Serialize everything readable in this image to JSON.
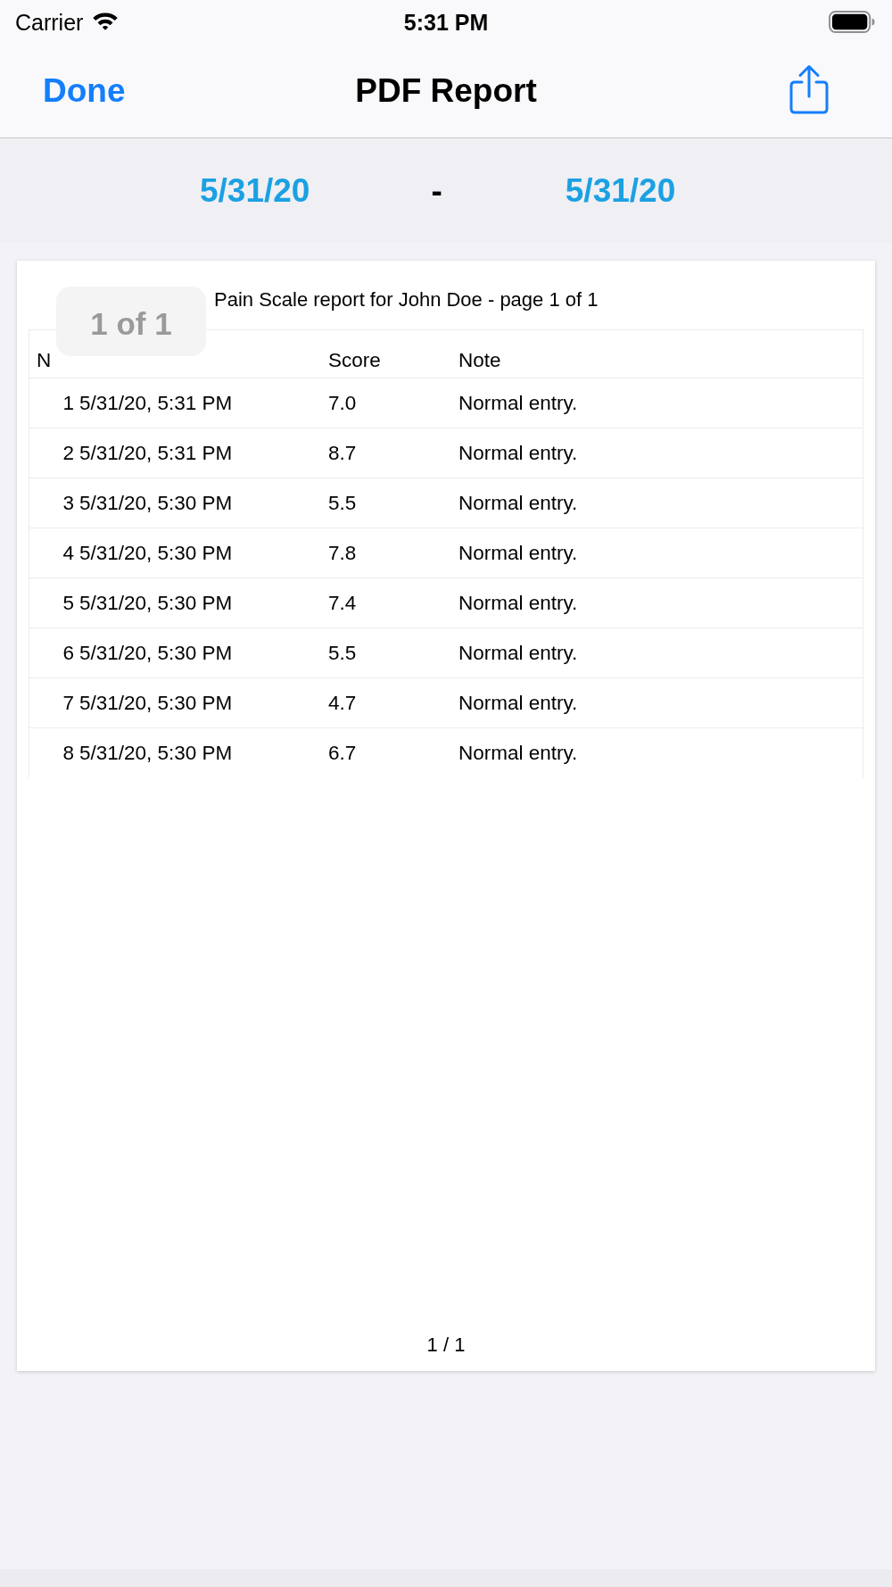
{
  "status_bar": {
    "carrier": "Carrier",
    "time": "5:31 PM"
  },
  "nav_bar": {
    "done_button": "Done",
    "title": "PDF Report"
  },
  "date_range": {
    "start": "5/31/20",
    "separator": "-",
    "end": "5/31/20"
  },
  "pdf_page": {
    "page_indicator": "1 of 1",
    "title": "Pain Scale report for John Doe - page 1 of 1",
    "table": {
      "header": {
        "column_1": "N",
        "column_3": "Score",
        "column_4": "Note"
      },
      "rows": [
        [
          "1",
          "5/31/20, 5:31 PM",
          "7.0",
          "Normal entry."
        ],
        [
          "2",
          "5/31/20, 5:31 PM",
          "8.7",
          "Normal entry."
        ],
        [
          "3",
          "5/31/20, 5:30 PM",
          "5.5",
          "Normal entry."
        ],
        [
          "4",
          "5/31/20, 5:30 PM",
          "7.8",
          "Normal entry."
        ],
        [
          "5",
          "5/31/20, 5:30 PM",
          "7.4",
          "Normal entry."
        ],
        [
          "6",
          "5/31/20, 5:30 PM",
          "5.5",
          "Normal entry."
        ],
        [
          "7",
          "5/31/20, 5:30 PM",
          "4.7",
          "Normal entry."
        ],
        [
          "8",
          "5/31/20, 5:30 PM",
          "6.7",
          "Normal entry."
        ]
      ]
    },
    "footer": "1 / 1"
  }
}
